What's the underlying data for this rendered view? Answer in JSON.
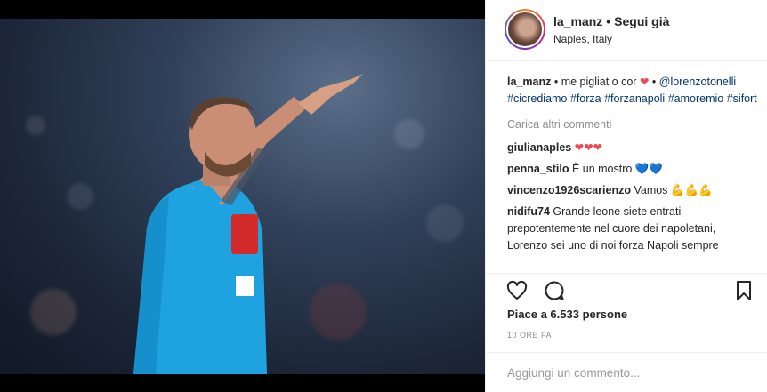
{
  "post": {
    "username": "la_manz",
    "separator": "•",
    "follow_label": "Segui già",
    "location": "Naples, Italy"
  },
  "caption": {
    "username": "la_manz",
    "bullet": "•",
    "text": "me pigliat o cor",
    "heart": "❤",
    "bullet2": "•",
    "mention": "@lorenzotonelli",
    "hashtags": [
      "#cicrediamo",
      "#forza",
      "#forzanapoli",
      "#amoremio",
      "#sifort"
    ]
  },
  "load_more": "Carica altri commenti",
  "comments": [
    {
      "user": "giulianaples",
      "text": "",
      "emoji": "❤❤❤"
    },
    {
      "user": "penna_stilo",
      "text": "È un mostro",
      "emoji": "💙💙"
    },
    {
      "user": "vincenzo1926scarienzo",
      "text": "Vamos",
      "emoji": "💪💪💪"
    },
    {
      "user": "nidifu74",
      "text": "Grande leone siete entrati prepotentemente nel cuore dei napoletani, Lorenzo sei uno di noi forza Napoli sempre",
      "emoji": ""
    }
  ],
  "likes_text": "Piace a 6.533 persone",
  "timestamp": "10 ORE FA",
  "add_comment_placeholder": "Aggiungi un commento...",
  "icons": {
    "like": "heart-icon",
    "comment": "comment-icon",
    "save": "bookmark-icon"
  },
  "colors": {
    "link": "#003569",
    "muted": "#8e8e8e",
    "heart": "#ed4956"
  }
}
